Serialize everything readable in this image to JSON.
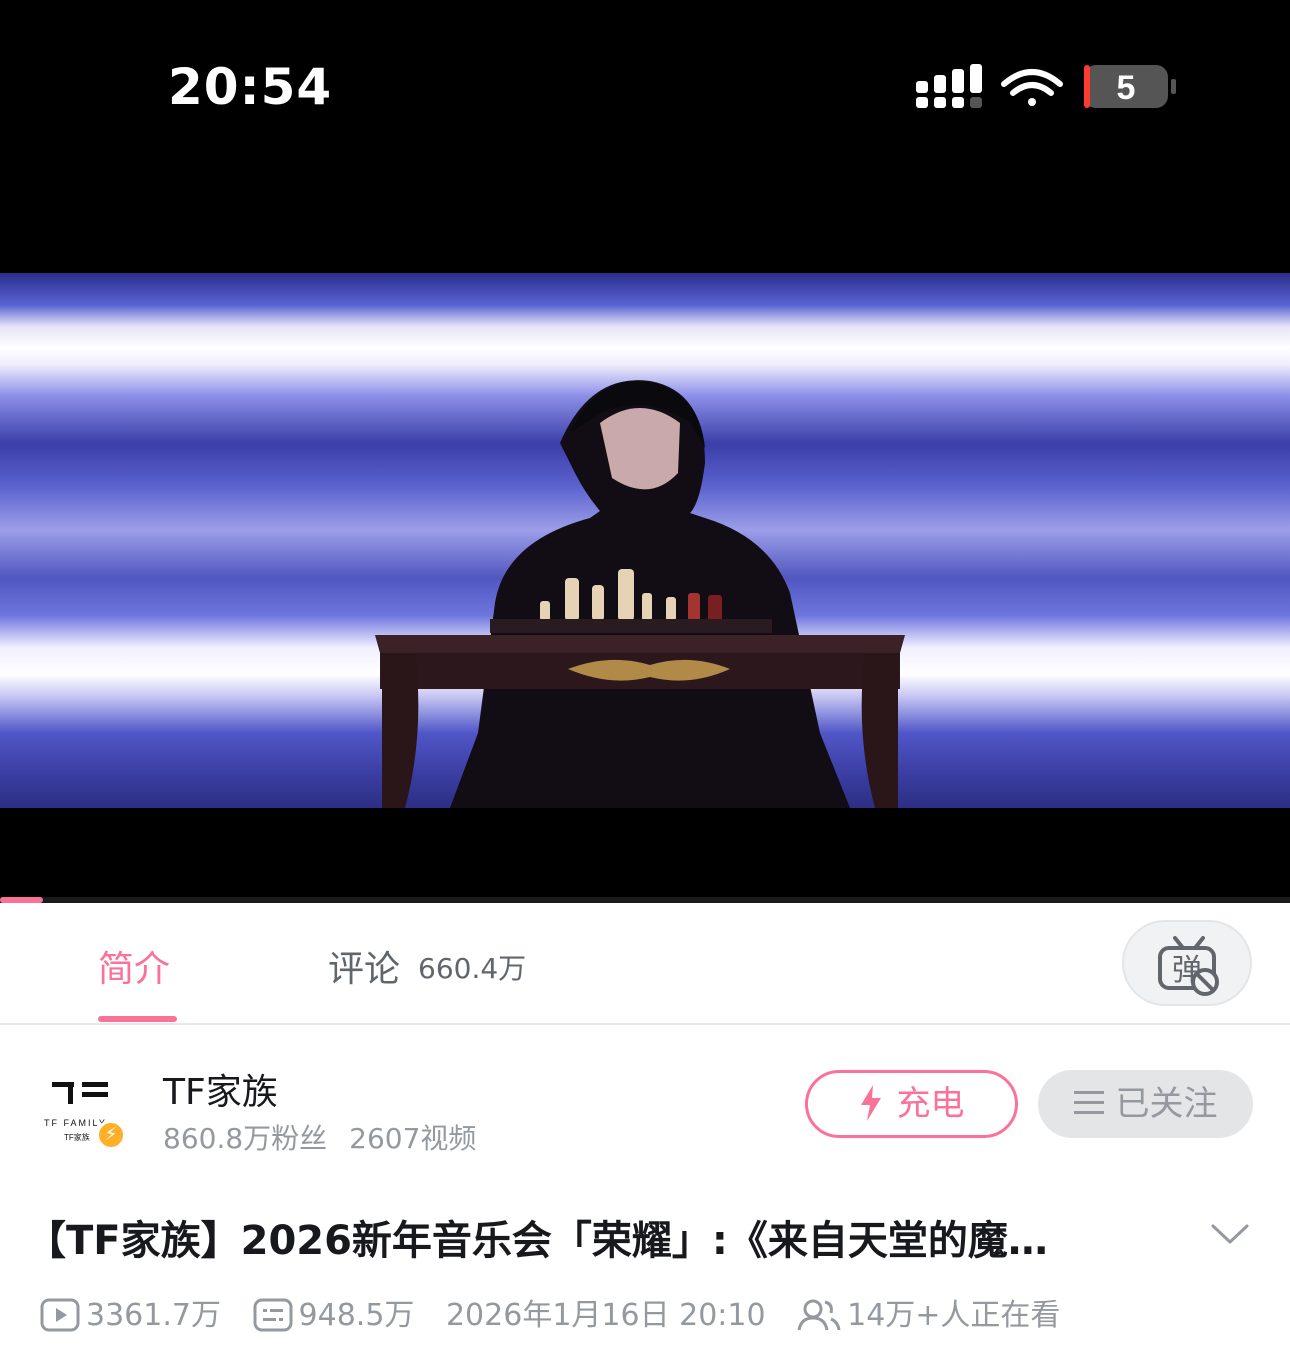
{
  "status_bar": {
    "time": "20:54",
    "battery": "5",
    "battery_color": "#ff3b30"
  },
  "player": {
    "progress": 0.033,
    "accent": "#fb7299"
  },
  "tabs": {
    "intro_label": "简介",
    "comments_label": "评论",
    "comments_count": "660.4万",
    "danmaku_icon": "danmaku-off-icon"
  },
  "uploader": {
    "name": "TF家族",
    "followers": "860.8万粉丝",
    "videos": "2607视频",
    "charge_label": "充电",
    "follow_label": "已关注"
  },
  "video": {
    "title": "【TF家族】2026新年音乐会「荣耀」:《来自天堂的魔…",
    "views": "3361.7万",
    "danmaku_count": "948.5万",
    "publish_time": "2026年1月16日 20:10",
    "watching_now": "14万+人正在看"
  }
}
